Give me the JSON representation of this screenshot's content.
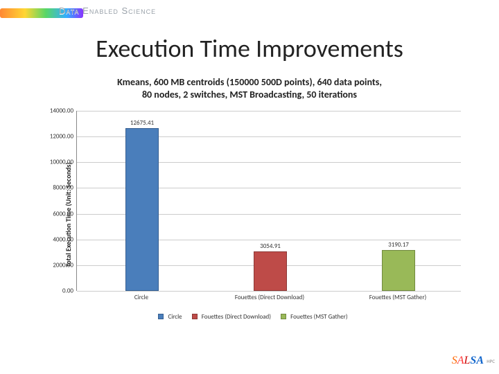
{
  "branding": {
    "top_text": "Data Enabled Science",
    "footer_logo_letters": [
      "S",
      "A",
      "L",
      "SA"
    ],
    "footer_sub": "HPC"
  },
  "slide_title": "Execution Time Improvements",
  "subtitle_line1": "Kmeans, 600 MB centroids (150000 500D points), 640 data points,",
  "subtitle_line2": "80 nodes, 2 switches, MST Broadcasting, 50 iterations",
  "yaxis_label": "Total Execution Time (Unit: Seconds)",
  "categories": {
    "c0": "Circle",
    "c1": "Fouettes (Direct Download)",
    "c2": "Fouettes (MST Gather)"
  },
  "values": {
    "v0": "12675.41",
    "v1": "3054.91",
    "v2": "3190.17"
  },
  "chart_data": {
    "type": "bar",
    "title": "Kmeans, 600 MB centroids (150000 500D points), 640 data points, 80 nodes, 2 switches, MST Broadcasting, 50 iterations",
    "xlabel": "",
    "ylabel": "Total Execution Time (Unit: Seconds)",
    "ylim": [
      0,
      14000
    ],
    "ytick_step": 2000,
    "categories": [
      "Circle",
      "Fouettes (Direct Download)",
      "Fouettes (MST Gather)"
    ],
    "values": [
      12675.41,
      3054.91,
      3190.17
    ],
    "colors": [
      "#4a7ebb",
      "#be4b48",
      "#99b958"
    ],
    "legend_entries": [
      "Circle",
      "Fouettes (Direct Download)",
      "Fouettes (MST Gather)"
    ]
  },
  "yticks": {
    "t0": "0.00",
    "t1": "2000.00",
    "t2": "4000.00",
    "t3": "6000.00",
    "t4": "8000.00",
    "t5": "10000.00",
    "t6": "12000.00",
    "t7": "14000.00"
  },
  "legend": {
    "l0": "Circle",
    "l1": "Fouettes (Direct Download)",
    "l2": "Fouettes (MST Gather)"
  }
}
